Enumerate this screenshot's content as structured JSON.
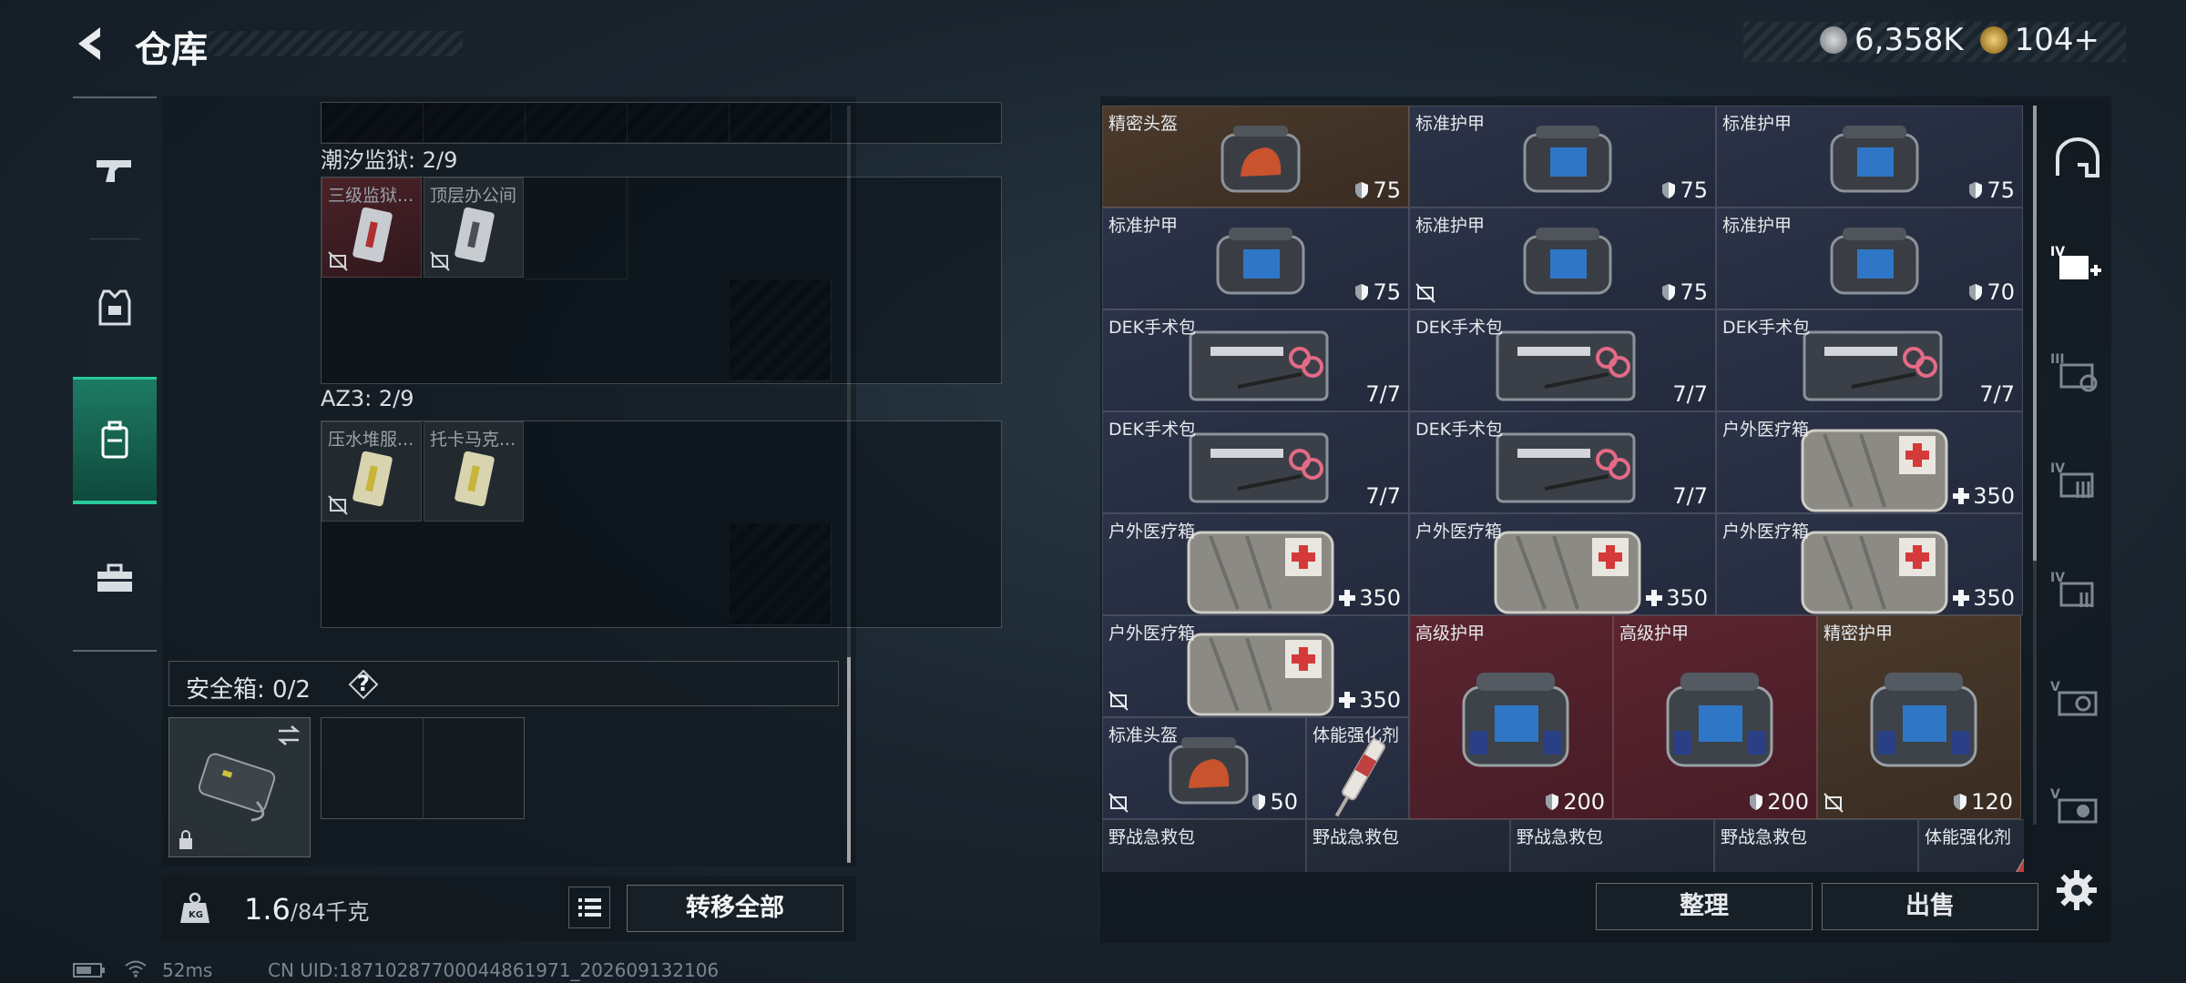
{
  "header": {
    "title": "仓库",
    "currency": [
      {
        "icon": "silver-coin-icon",
        "value": "6,358K"
      },
      {
        "icon": "gold-coin-icon",
        "value": "104+"
      }
    ]
  },
  "left_rail": [
    "gun-icon",
    "armor-vest-icon",
    "backpack-icon",
    "toolbox-icon"
  ],
  "storage": {
    "sections": [
      {
        "title": "潮汐监狱: 2/9",
        "items": [
          "三级监狱...",
          "顶层办公间"
        ]
      },
      {
        "title": "AZ3: 2/9",
        "items": [
          "压水堆服...",
          "托卡马克..."
        ]
      }
    ],
    "safebox_label": "安全箱: 0/2",
    "help": "?"
  },
  "weight": {
    "current": "1.6",
    "capacity": "/84千克",
    "icon_text": "KG"
  },
  "buttons": {
    "transfer_all": "转移全部",
    "sort": "整理",
    "sell": "出售"
  },
  "status": {
    "ping": "52ms",
    "uid": "CN UID:18710287700044861971_202609132106"
  },
  "inventory": {
    "items": [
      {
        "name": "精密头盔",
        "value": "75",
        "kind": "shield",
        "color": "brown",
        "art": "helmet"
      },
      {
        "name": "标准护甲",
        "value": "75",
        "kind": "shield",
        "color": "blue",
        "art": "vest"
      },
      {
        "name": "标准护甲",
        "value": "75",
        "kind": "shield",
        "color": "blue",
        "art": "vest"
      },
      {
        "name": "标准护甲",
        "value": "75",
        "kind": "shield",
        "color": "blue",
        "art": "vest"
      },
      {
        "name": "标准护甲",
        "value": "75",
        "kind": "shield",
        "color": "blue",
        "art": "vest"
      },
      {
        "name": "标准护甲",
        "value": "70",
        "kind": "shield",
        "color": "blue",
        "art": "vest"
      },
      {
        "name": "DEK手术包",
        "value": "7/7",
        "kind": "none",
        "color": "blue",
        "art": "kit"
      },
      {
        "name": "DEK手术包",
        "value": "7/7",
        "kind": "none",
        "color": "blue",
        "art": "kit"
      },
      {
        "name": "DEK手术包",
        "value": "7/7",
        "kind": "none",
        "color": "blue",
        "art": "kit"
      },
      {
        "name": "DEK手术包",
        "value": "7/7",
        "kind": "none",
        "color": "blue",
        "art": "kit"
      },
      {
        "name": "DEK手术包",
        "value": "7/7",
        "kind": "none",
        "color": "blue",
        "art": "kit"
      },
      {
        "name": "户外医疗箱",
        "value": "350",
        "kind": "plus",
        "color": "blue",
        "art": "medbox"
      },
      {
        "name": "户外医疗箱",
        "value": "350",
        "kind": "plus",
        "color": "blue",
        "art": "medbox"
      },
      {
        "name": "户外医疗箱",
        "value": "350",
        "kind": "plus",
        "color": "blue",
        "art": "medbox"
      },
      {
        "name": "户外医疗箱",
        "value": "350",
        "kind": "plus",
        "color": "blue",
        "art": "medbox"
      },
      {
        "name": "户外医疗箱",
        "value": "350",
        "kind": "plus",
        "color": "blue",
        "art": "medbox"
      },
      {
        "name": "高级护甲",
        "value": "200",
        "kind": "shield",
        "color": "red",
        "art": "bigvest"
      },
      {
        "name": "高级护甲",
        "value": "200",
        "kind": "shield",
        "color": "red",
        "art": "bigvest"
      },
      {
        "name": "精密护甲",
        "value": "120",
        "kind": "shield",
        "color": "brown",
        "art": "bigvest"
      },
      {
        "name": "标准头盔",
        "value": "50",
        "kind": "shield",
        "color": "blue",
        "art": "helmet"
      },
      {
        "name": "体能强化剂",
        "value": "",
        "kind": "none",
        "color": "blue",
        "art": "syringe"
      },
      {
        "name": "野战急救包",
        "value": "",
        "kind": "none",
        "color": "dark",
        "art": "pouch"
      },
      {
        "name": "野战急救包",
        "value": "",
        "kind": "none",
        "color": "dark",
        "art": "pouch"
      },
      {
        "name": "野战急救包",
        "value": "",
        "kind": "none",
        "color": "dark",
        "art": "pouch"
      },
      {
        "name": "野战急救包",
        "value": "",
        "kind": "none",
        "color": "dark",
        "art": "pouch"
      },
      {
        "name": "体能强化剂",
        "value": "",
        "kind": "none",
        "color": "dark",
        "art": "syringe"
      }
    ]
  },
  "right_filters": [
    "helmet-filter-icon",
    "medkit-filter-icon",
    "ammo-iii-filter-icon",
    "ammo-iv-filter-icon",
    "ammo-iv-alt-filter-icon",
    "ammo-v-filter-icon",
    "ammo-v-alt-filter-icon"
  ],
  "colors": {
    "accent": "#28c99a",
    "brown": "#4a3a2c",
    "blue": "#2c3348",
    "red": "#5c2530"
  }
}
